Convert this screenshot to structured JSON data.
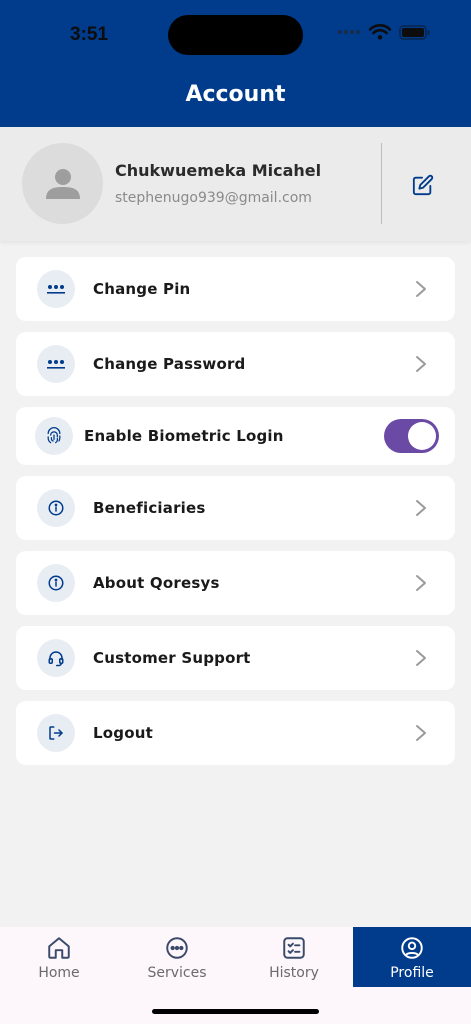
{
  "status_bar": {
    "time": "3:51"
  },
  "header": {
    "title": "Account"
  },
  "profile": {
    "name": "Chukwuemeka Micahel",
    "email": "stephenugo939@gmail.com"
  },
  "menu": {
    "change_pin": "Change Pin",
    "change_password": "Change Password",
    "biometric": "Enable Biometric Login",
    "biometric_enabled": true,
    "beneficiaries": "Beneficiaries",
    "about": "About Qoresys",
    "support": "Customer Support",
    "logout": "Logout"
  },
  "tabs": {
    "home": "Home",
    "services": "Services",
    "history": "History",
    "profile": "Profile",
    "active": "profile"
  },
  "colors": {
    "brand": "#003b8c",
    "toggle_on": "#6a4aa5",
    "background": "#f2f2f2"
  }
}
